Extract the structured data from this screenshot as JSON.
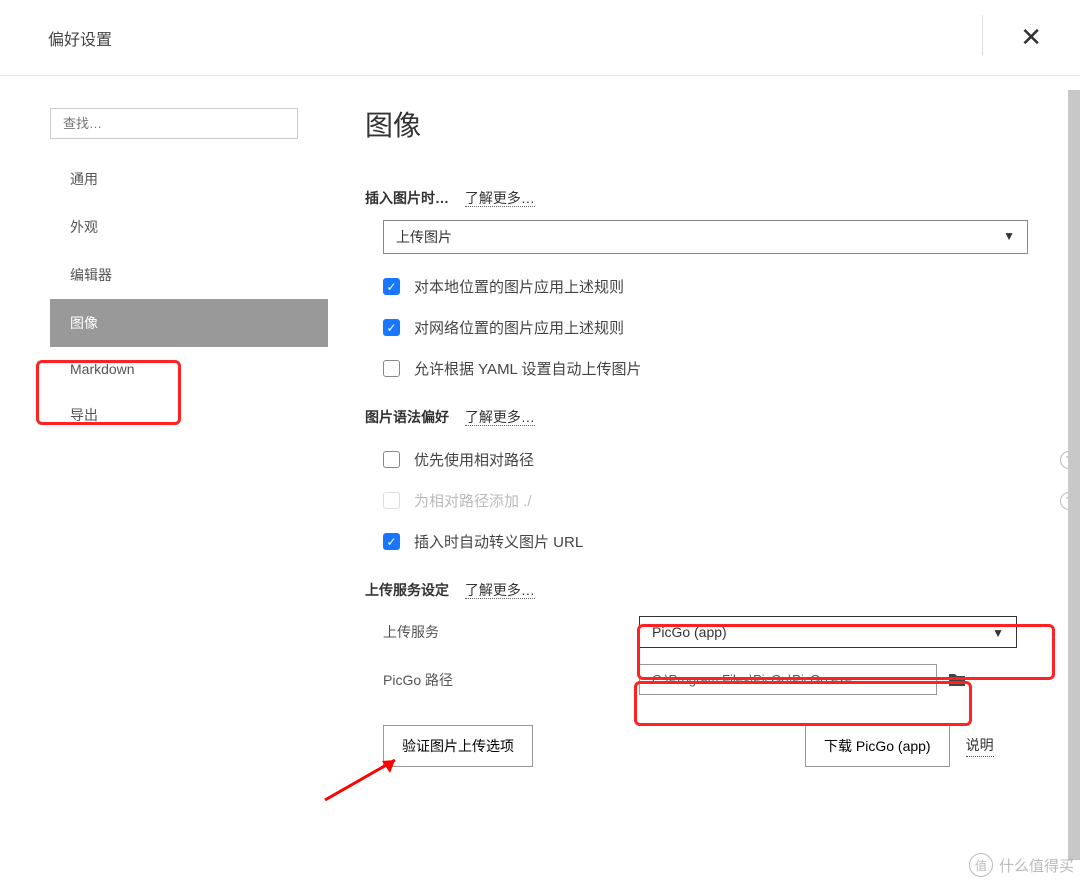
{
  "titlebar": {
    "title": "偏好设置"
  },
  "sidebar": {
    "search_placeholder": "查找…",
    "items": [
      {
        "label": "通用"
      },
      {
        "label": "外观"
      },
      {
        "label": "编辑器"
      },
      {
        "label": "图像"
      },
      {
        "label": "Markdown"
      },
      {
        "label": "导出"
      }
    ]
  },
  "main": {
    "heading": "图像",
    "insert_section": {
      "label": "插入图片时…",
      "learn_more": "了解更多…",
      "action_select": "上传图片",
      "checks": [
        {
          "label": "对本地位置的图片应用上述规则",
          "checked": true
        },
        {
          "label": "对网络位置的图片应用上述规则",
          "checked": true
        },
        {
          "label": "允许根据 YAML 设置自动上传图片",
          "checked": false
        }
      ]
    },
    "syntax_section": {
      "label": "图片语法偏好",
      "learn_more": "了解更多…",
      "checks": [
        {
          "label": "优先使用相对路径",
          "checked": false,
          "help": true
        },
        {
          "label": "为相对路径添加 ./",
          "checked": false,
          "disabled": true,
          "help": true
        },
        {
          "label": "插入时自动转义图片 URL",
          "checked": true
        }
      ]
    },
    "upload_section": {
      "label": "上传服务设定",
      "learn_more": "了解更多…",
      "uploader_label": "上传服务",
      "uploader_value": "PicGo (app)",
      "path_label": "PicGo 路径",
      "path_value": "C:\\Program Files\\PicGo\\PicGo.exe",
      "verify_btn": "验证图片上传选项",
      "download_btn": "下载 PicGo (app)",
      "desc_link": "说明"
    }
  },
  "watermark": "什么值得买"
}
